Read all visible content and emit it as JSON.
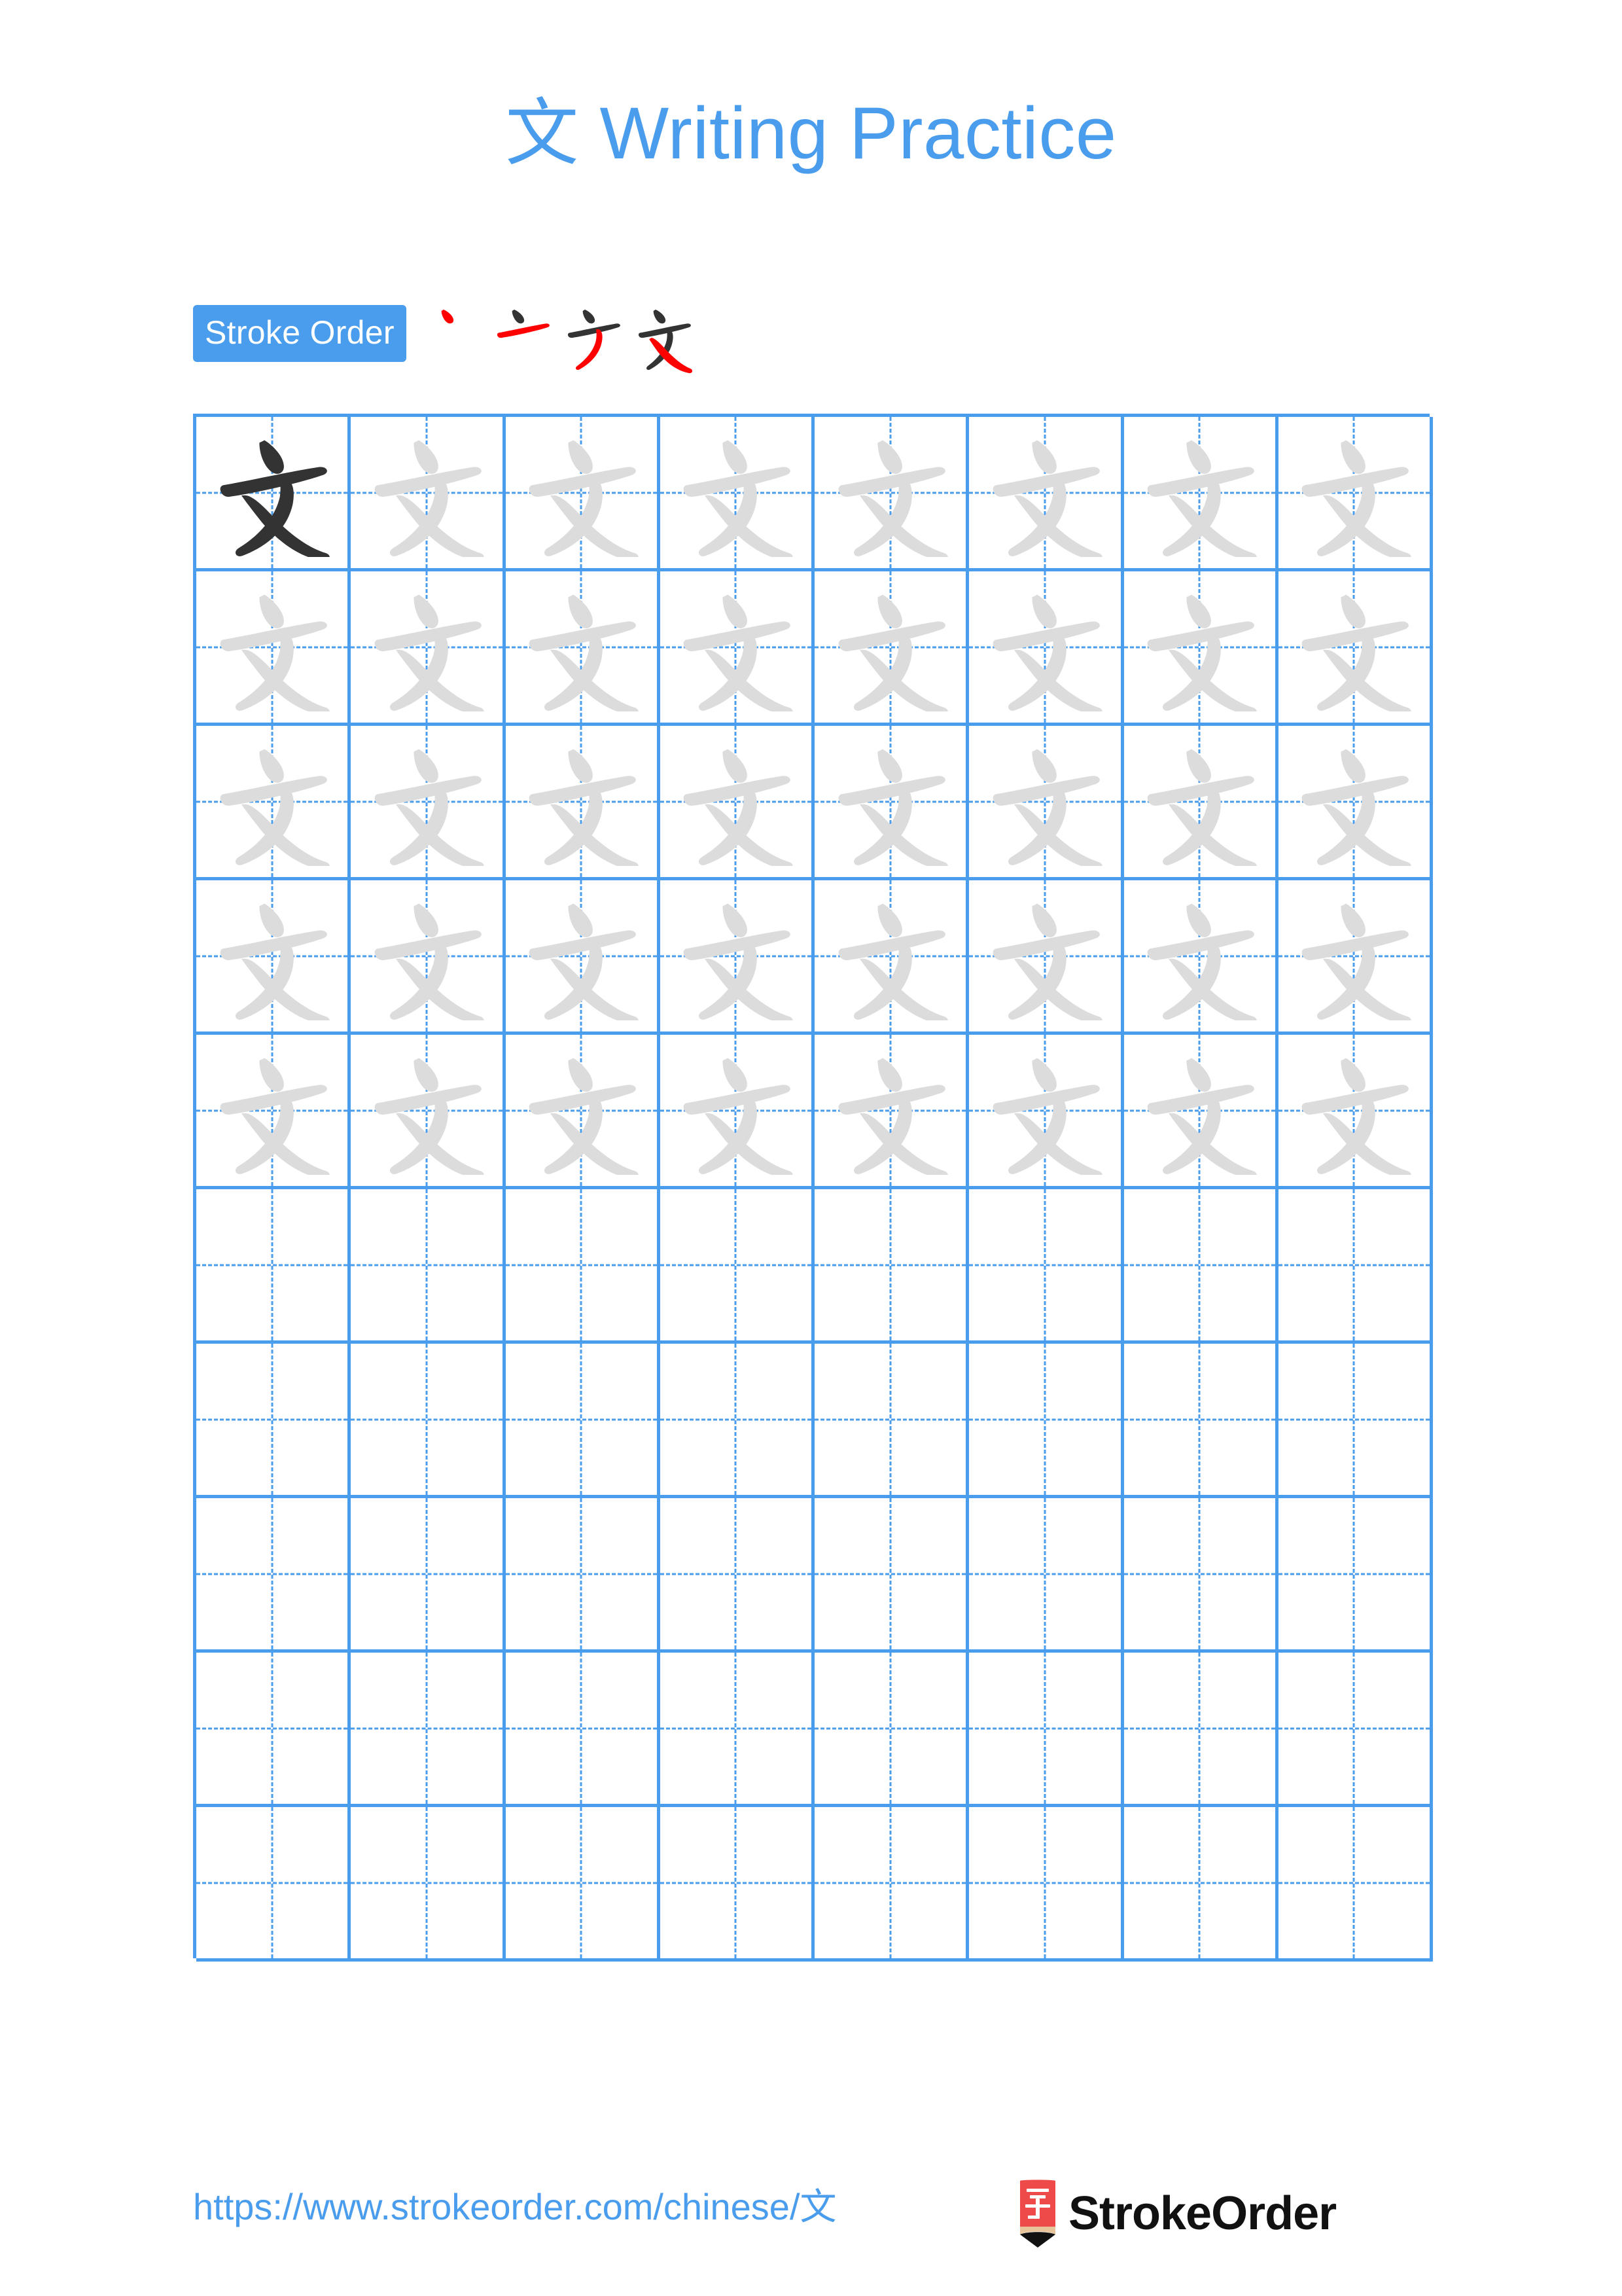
{
  "page": {
    "character": "文",
    "title_text": "Writing Practice",
    "title_full": "文 Writing Practice",
    "accent_color": "#4a9ded",
    "grid_line_color": "#4a9ded",
    "ink_color": "#333333",
    "trace_color": "#dcdcdc",
    "highlight_stroke_color": "#ff0000",
    "background_color": "#ffffff"
  },
  "stroke_order": {
    "badge_label": "Stroke Order",
    "total_strokes": 4,
    "steps": [
      {
        "index": 1,
        "new_stroke": "dian-dot",
        "description": "dot"
      },
      {
        "index": 2,
        "new_stroke": "heng-horizontal",
        "description": "horizontal"
      },
      {
        "index": 3,
        "new_stroke": "pie-left-falling",
        "description": "left-falling"
      },
      {
        "index": 4,
        "new_stroke": "na-right-falling",
        "description": "right-falling"
      }
    ]
  },
  "practice_grid": {
    "columns": 8,
    "rows": 10,
    "rows_with_content": 5,
    "row_fill": [
      [
        "ink",
        "trace",
        "trace",
        "trace",
        "trace",
        "trace",
        "trace",
        "trace"
      ],
      [
        "trace",
        "trace",
        "trace",
        "trace",
        "trace",
        "trace",
        "trace",
        "trace"
      ],
      [
        "trace",
        "trace",
        "trace",
        "trace",
        "trace",
        "trace",
        "trace",
        "trace"
      ],
      [
        "trace",
        "trace",
        "trace",
        "trace",
        "trace",
        "trace",
        "trace",
        "trace"
      ],
      [
        "trace",
        "trace",
        "trace",
        "trace",
        "trace",
        "trace",
        "trace",
        "trace"
      ],
      [
        "empty",
        "empty",
        "empty",
        "empty",
        "empty",
        "empty",
        "empty",
        "empty"
      ],
      [
        "empty",
        "empty",
        "empty",
        "empty",
        "empty",
        "empty",
        "empty",
        "empty"
      ],
      [
        "empty",
        "empty",
        "empty",
        "empty",
        "empty",
        "empty",
        "empty",
        "empty"
      ],
      [
        "empty",
        "empty",
        "empty",
        "empty",
        "empty",
        "empty",
        "empty",
        "empty"
      ],
      [
        "empty",
        "empty",
        "empty",
        "empty",
        "empty",
        "empty",
        "empty",
        "empty"
      ]
    ]
  },
  "footer": {
    "url": "https://www.strokeorder.com/chinese/文",
    "logo_text": "StrokeOrder",
    "logo_character": "字",
    "logo_body_color": "#ef4a4a",
    "logo_wood_color": "#e8c49a",
    "logo_tip_color": "#111111"
  }
}
